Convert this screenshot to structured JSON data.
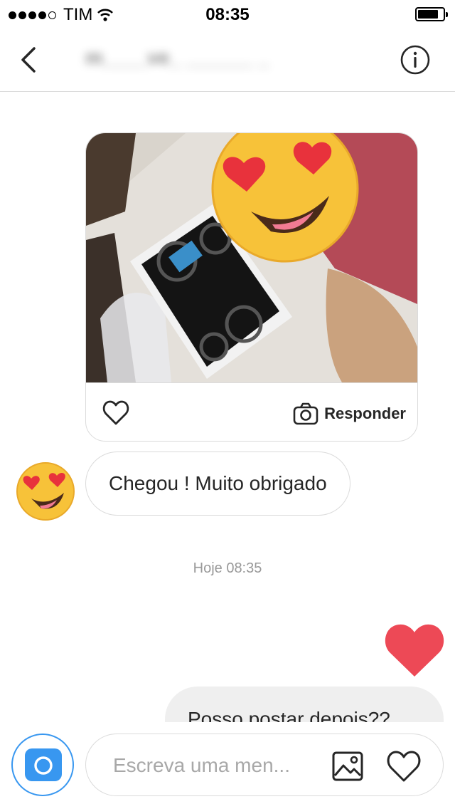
{
  "status_bar": {
    "carrier": "TIM",
    "time": "08:35",
    "signal_filled": 4,
    "signal_total": 5
  },
  "header": {
    "username": "m____ve_ ______ _",
    "back_icon": "chevron-left-icon",
    "info_icon": "info-circle-icon"
  },
  "messages": {
    "shared_post": {
      "reply_label": "Responder",
      "like_icon": "heart-outline-icon",
      "reply_icon": "camera-outline-icon"
    },
    "received_text": "Chegou !  Muito obrigado",
    "timestamp": "Hoje 08:35",
    "sent_reaction": "heart",
    "sent_text": "Posso postar depois??"
  },
  "composer": {
    "placeholder": "Escreva uma men...",
    "camera_icon": "camera-icon",
    "gallery_icon": "image-icon",
    "heart_icon": "heart-outline-icon"
  },
  "colors": {
    "accent_blue": "#3897f0",
    "heart_red": "#ed4956",
    "sent_bubble": "#efefef",
    "border": "#dbdbdb"
  }
}
